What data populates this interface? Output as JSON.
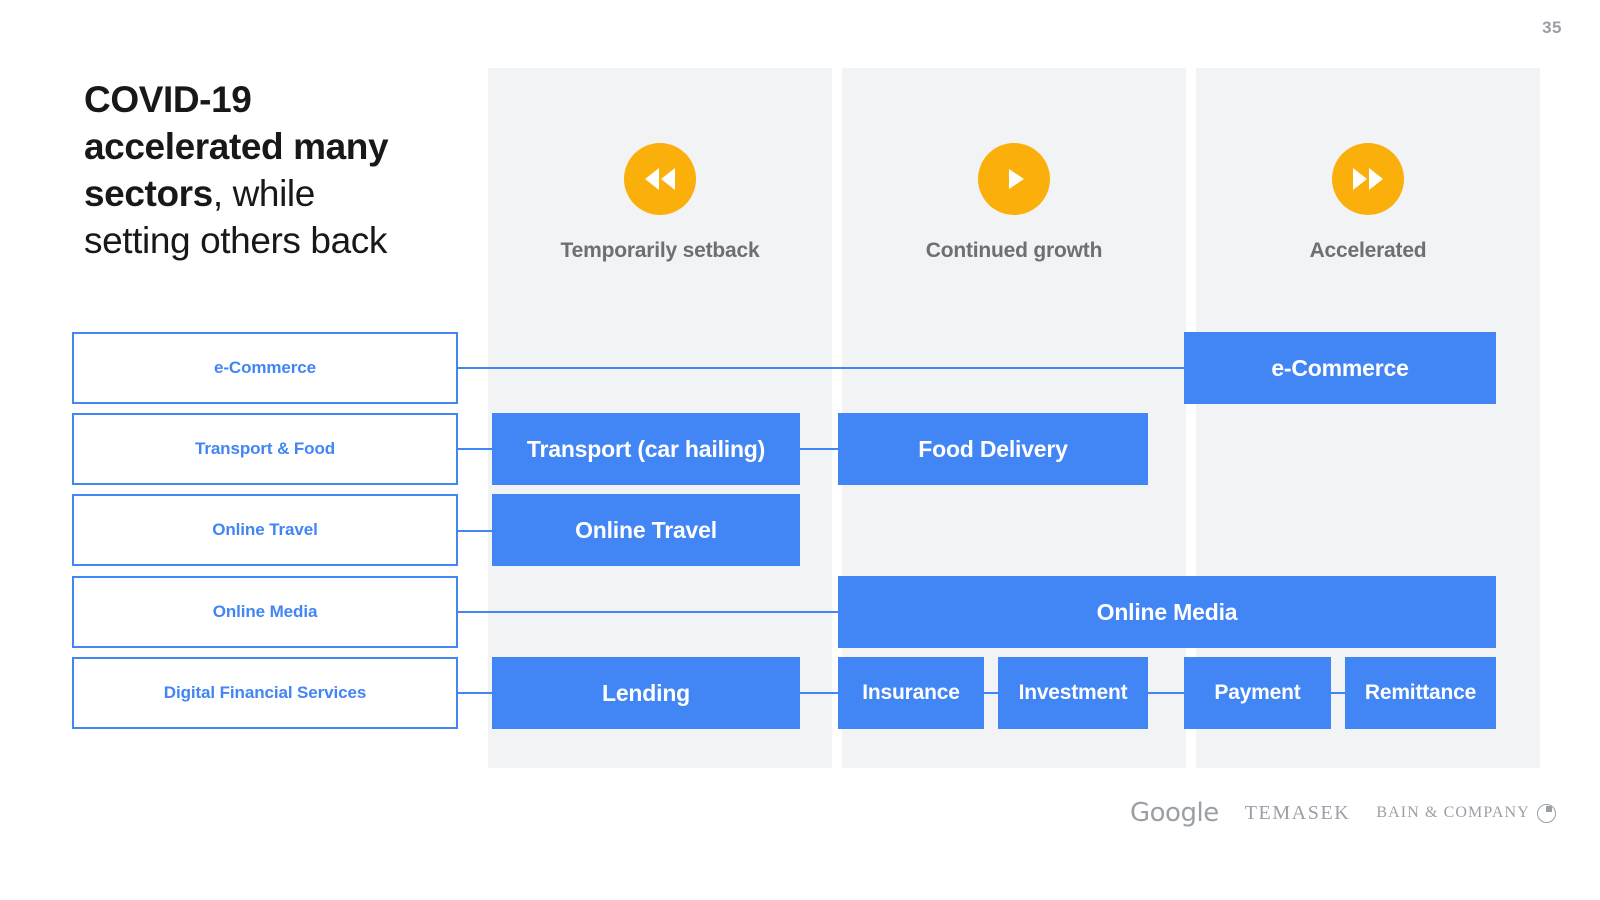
{
  "page_number": "35",
  "title": {
    "line1_strong": "COVID-19",
    "line2_strong": "accelerated many",
    "line3_strong": "sectors",
    "line3_light": ", while",
    "line4_light": "setting others back"
  },
  "columns": [
    {
      "label": "Temporarily setback",
      "icon": "rewind-icon"
    },
    {
      "label": "Continued growth",
      "icon": "play-icon"
    },
    {
      "label": "Accelerated",
      "icon": "fast-forward-icon"
    }
  ],
  "sectors": [
    {
      "label": "e-Commerce"
    },
    {
      "label": "Transport & Food"
    },
    {
      "label": "Online Travel"
    },
    {
      "label": "Online Media"
    },
    {
      "label": "Digital Financial Services"
    }
  ],
  "boxes": [
    {
      "label": "e-Commerce",
      "row": "e-Commerce",
      "column": "Accelerated"
    },
    {
      "label": "Transport (car hailing)",
      "row": "Transport & Food",
      "column": "Temporarily setback"
    },
    {
      "label": "Food Delivery",
      "row": "Transport & Food",
      "column": "Continued growth"
    },
    {
      "label": "Online Travel",
      "row": "Online Travel",
      "column": "Temporarily setback"
    },
    {
      "label": "Online Media",
      "row": "Online Media",
      "column": "Continued growth / Accelerated"
    },
    {
      "label": "Lending",
      "row": "Digital Financial Services",
      "column": "Temporarily setback"
    },
    {
      "label": "Insurance",
      "row": "Digital Financial Services",
      "column": "Continued growth"
    },
    {
      "label": "Investment",
      "row": "Digital Financial Services",
      "column": "Continued growth"
    },
    {
      "label": "Payment",
      "row": "Digital Financial Services",
      "column": "Accelerated"
    },
    {
      "label": "Remittance",
      "row": "Digital Financial Services",
      "column": "Accelerated"
    }
  ],
  "footer": {
    "google": "Google",
    "temasek": "TEMASEK",
    "bain": "BAIN & COMPANY"
  },
  "colors": {
    "blue": "#4285f4",
    "amber": "#fbaf0a",
    "panel_gray": "#f1f3f4",
    "label_gray": "#6b7074"
  }
}
